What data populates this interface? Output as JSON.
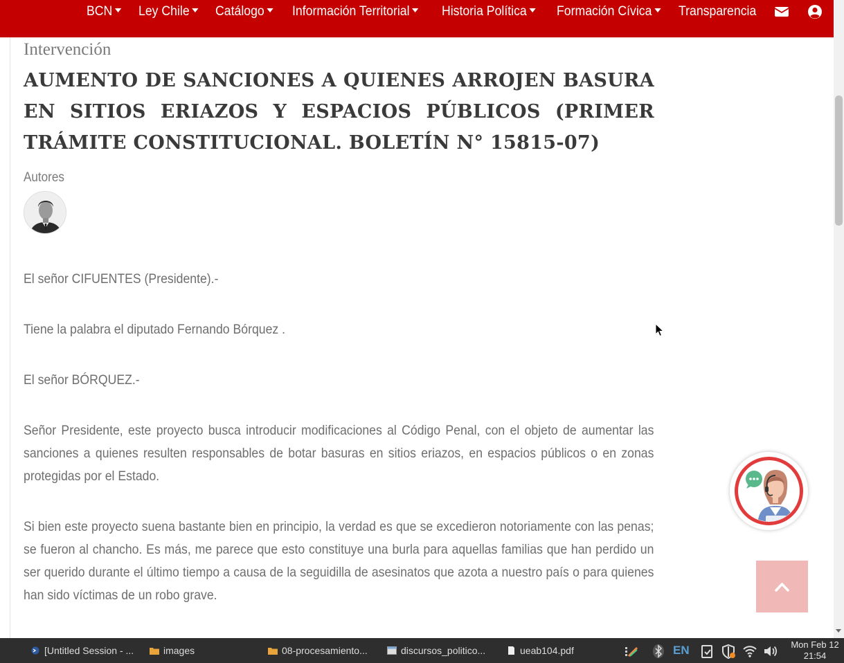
{
  "nav": {
    "items": [
      {
        "label": "BCN",
        "dropdown": true
      },
      {
        "label": "Ley Chile",
        "dropdown": true
      },
      {
        "label": "Catálogo",
        "dropdown": true
      },
      {
        "label": "Información Territorial",
        "dropdown": true
      },
      {
        "label": "Historia Política",
        "dropdown": true
      },
      {
        "label": "Formación Cívica",
        "dropdown": true
      },
      {
        "label": "Transparencia",
        "dropdown": false
      }
    ],
    "icons": [
      "envelope-icon",
      "user-circle-icon"
    ],
    "bg_color": "#c40000"
  },
  "article": {
    "kind": "Intervención",
    "title": "AUMENTO DE SANCIONES A QUIENES ARROJEN BASURA EN SITIOS ERIAZOS Y ESPACIOS PÚBLICOS (PRIMER TRÁMITE CONSTITUCIONAL. BOLETÍN N° 15815-07)",
    "authors_label": "Autores",
    "paragraphs": [
      "El señor CIFUENTES (Presidente).-",
      "Tiene la palabra el diputado Fernando Bórquez .",
      "El señor BÓRQUEZ.-",
      "Señor Presidente, este proyecto busca introducir modificaciones al Código Penal, con el objeto de aumentar las sanciones a quienes resulten responsables de botar basuras en sitios eriazos, en espacios públicos o en zonas protegidas por el Estado.",
      "Si bien este proyecto suena bastante bien en principio, la verdad es que se excedieron notoriamente con las penas; se fueron al chancho. Es más, me parece que esto constituye una burla para aquellas familias que han perdido un ser querido durante el último tiempo a causa de la seguidilla de asesinatos que azota a nuestro país o para quienes han sido víctimas de un robo grave."
    ]
  },
  "taskbar": {
    "tasks": [
      {
        "label": "[Untitled Session - ...",
        "icon": "terminal-icon"
      },
      {
        "label": "images",
        "icon": "folder-icon"
      },
      {
        "label": "08-procesamiento...",
        "icon": "folder-icon"
      },
      {
        "label": "discursos_politico...",
        "icon": "window-icon"
      },
      {
        "label": "ueab104.pdf",
        "icon": "document-icon"
      }
    ],
    "lang": "EN",
    "clock_day": "Mon Feb 12",
    "clock_time": "21:54"
  }
}
